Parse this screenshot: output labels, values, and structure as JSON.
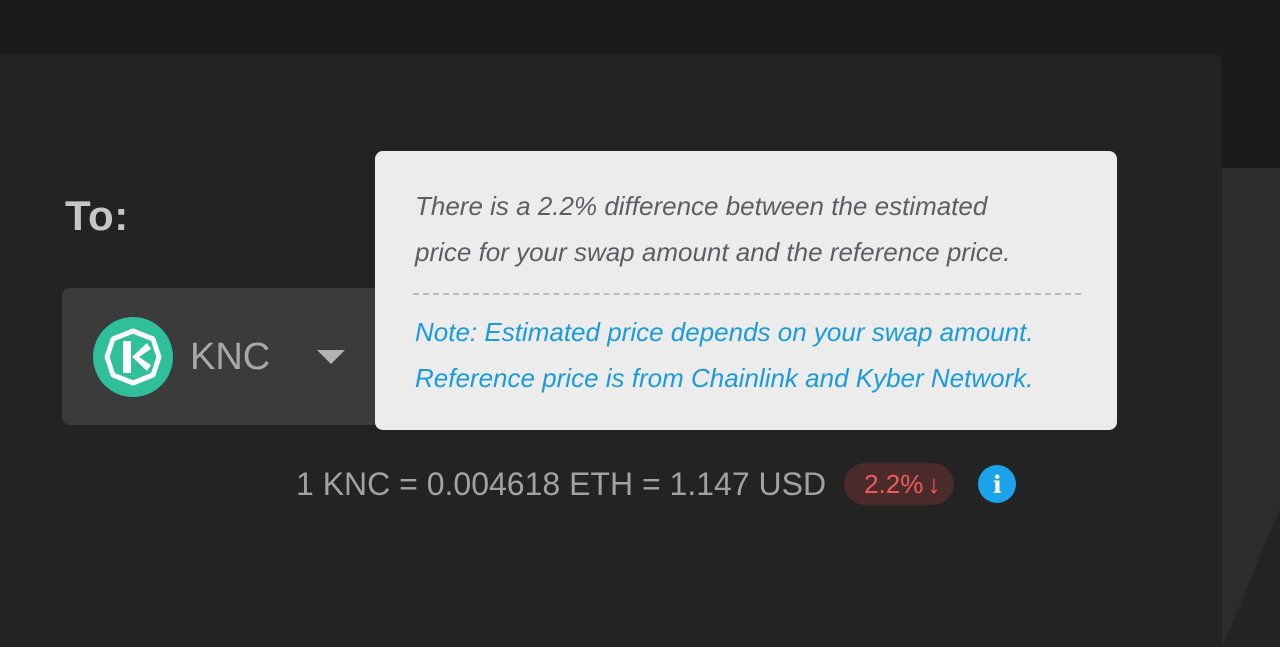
{
  "swap": {
    "to_label": "To:",
    "token": {
      "symbol": "KNC",
      "logo_icon": "kyber-knc-logo-icon",
      "dropdown_icon": "chevron-down-icon"
    },
    "rate": {
      "text": "1 KNC = 0.004618 ETH = 1.147 USD",
      "difference": "2.2%",
      "difference_icon": "arrow-down-icon",
      "info_icon": "info-icon"
    }
  },
  "tooltip": {
    "line1": "There is a 2.2% difference between the estimated",
    "line2": "price for your swap amount and the reference price.",
    "note_line1": "Note: Estimated price depends on your swap amount.",
    "note_line2": "Reference price is from Chainlink and Kyber Network."
  },
  "colors": {
    "background": "#1b1b1b",
    "card": "#232323",
    "token_select": "#3b3b3b",
    "knc_green": "#2fbf9a",
    "tooltip_bg": "#ececec",
    "accent_blue": "#1aa3ea",
    "negative_red": "#ef5b5b"
  }
}
